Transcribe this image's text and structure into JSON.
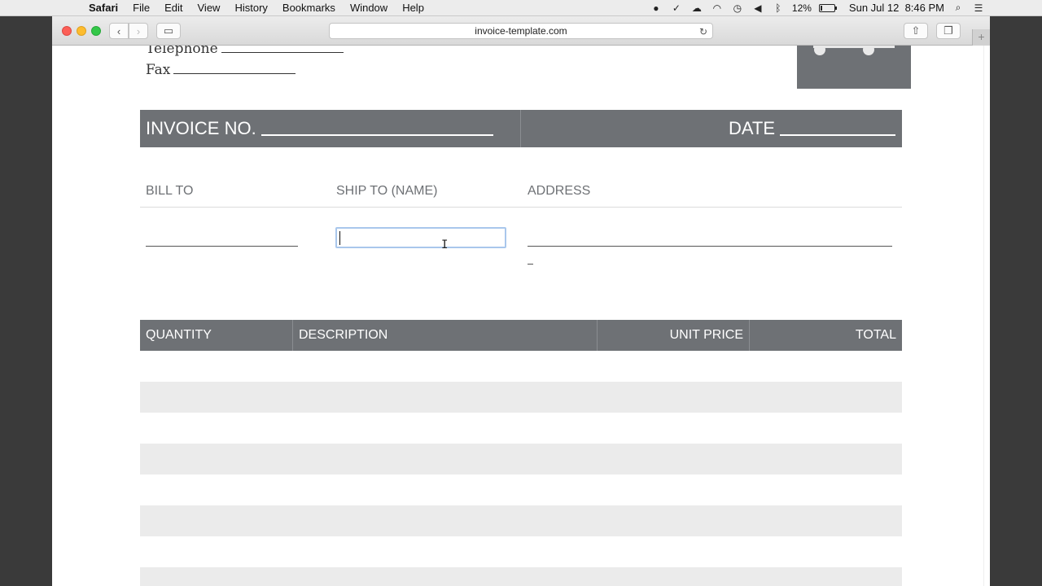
{
  "menubar": {
    "app": "Safari",
    "items": [
      "File",
      "Edit",
      "View",
      "History",
      "Bookmarks",
      "Window",
      "Help"
    ],
    "battery": "12%",
    "battery_level": 0.12,
    "clock": "Sun Jul 12  8:46 PM"
  },
  "browser": {
    "url": "invoice-template.com"
  },
  "invoice": {
    "telephone_label": "Telephone",
    "fax_label": "Fax",
    "invoice_no_label": "INVOICE NO.",
    "date_label": "DATE",
    "bill_to": "BILL TO",
    "ship_to": "SHIP TO (NAME)",
    "address": "ADDRESS",
    "ship_to_value": "",
    "table": {
      "headers": [
        "QUANTITY",
        "DESCRIPTION",
        "UNIT PRICE",
        "TOTAL"
      ]
    }
  }
}
